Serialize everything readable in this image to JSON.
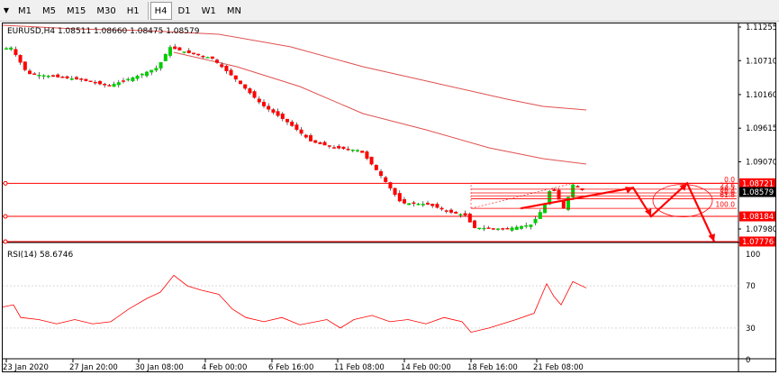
{
  "toolbar": {
    "menu_icon": "triangle-down-icon",
    "timeframes": [
      {
        "label": "M1",
        "active": false
      },
      {
        "label": "M5",
        "active": false
      },
      {
        "label": "M15",
        "active": false
      },
      {
        "label": "M30",
        "active": false
      },
      {
        "label": "H1",
        "active": false
      },
      {
        "label": "H4",
        "active": true
      },
      {
        "label": "D1",
        "active": false
      },
      {
        "label": "W1",
        "active": false
      },
      {
        "label": "MN",
        "active": false
      }
    ]
  },
  "symbol_header": "EURUSD,H4  1.08511 1.08660 1.08475 1.08579",
  "price_axis": {
    "ticks": [
      "1.11255",
      "1.10710",
      "1.10160",
      "1.09615",
      "1.09070",
      "1.07980"
    ],
    "markers": [
      {
        "label": "1.08721",
        "value": 1.08721,
        "bg": "#ff0000",
        "fg": "#ffffff"
      },
      {
        "label": "1.08579",
        "value": 1.08579,
        "bg": "#000000",
        "fg": "#ffffff"
      },
      {
        "label": "1.08184",
        "value": 1.08184,
        "bg": "#ff0000",
        "fg": "#ffffff"
      },
      {
        "label": "1.07776",
        "value": 1.07776,
        "bg": "#ff0000",
        "fg": "#ffffff"
      }
    ]
  },
  "fibonacci": {
    "levels": [
      {
        "label": "0.0",
        "value": 1.08721
      },
      {
        "label": "23.6",
        "value": 1.08625
      },
      {
        "label": "38.2",
        "value": 1.08565
      },
      {
        "label": "50.0",
        "value": 1.08517
      },
      {
        "label": "61.8",
        "value": 1.08469
      },
      {
        "label": "100.0",
        "value": 1.08314
      }
    ]
  },
  "rsi": {
    "header": "RSI(14) 58.6746",
    "ticks": [
      "100",
      "70",
      "30",
      "0"
    ]
  },
  "time_axis": {
    "labels": [
      "23 Jan 2020",
      "27 Jan 20:00",
      "30 Jan 08:00",
      "4 Feb 00:00",
      "6 Feb 16:00",
      "11 Feb 08:00",
      "14 Feb 00:00",
      "18 Feb 16:00",
      "21 Feb 08:00"
    ]
  },
  "colors": {
    "bull": "#00cc00",
    "bear": "#ff0000",
    "ma": "#e05050",
    "fib": "#ff0000",
    "drawing": "#ff0000",
    "rsi_line": "#ff0000"
  }
}
